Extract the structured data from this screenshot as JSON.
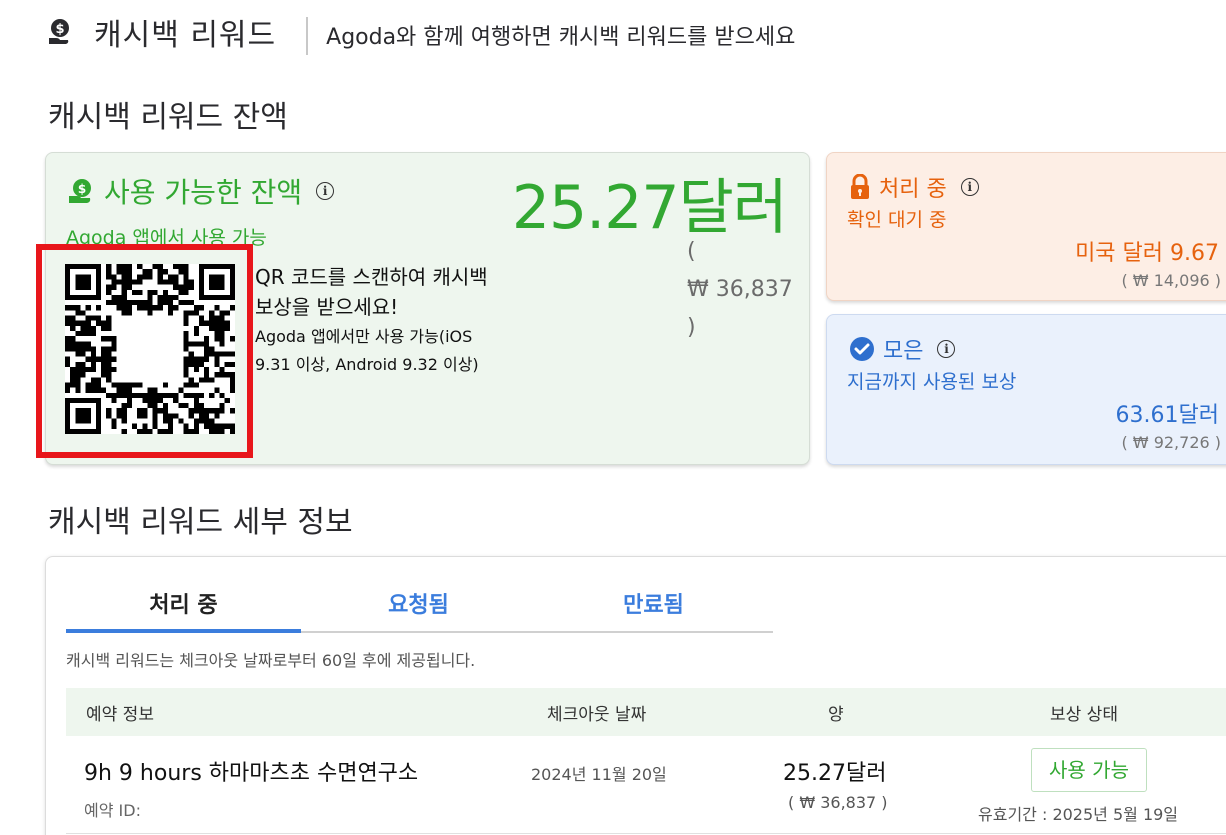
{
  "header": {
    "icon": "dollar-hand-icon",
    "title": "캐시백 리워드",
    "subtitle": "Agoda와 함께 여행하면 캐시백 리워드를 받으세요"
  },
  "balance_section": {
    "title": "캐시백 리워드 잔액",
    "available": {
      "title": "사용 가능한 잔액",
      "amount": "25.27달러",
      "subtitle": "Agoda 앱에서 사용 가능",
      "krw_open": "(",
      "krw_value": "₩ 36,837",
      "krw_close": ")",
      "qr_main": "QR 코드를 스캔하여 캐시백 보상을 받으세요!",
      "qr_sub": "Agoda 앱에서만 사용 가능(iOS 9.31 이상, Android 9.32 이상)"
    },
    "pending": {
      "title": "처리 중",
      "desc": "확인 대기 중",
      "amount": "미국 달러 9.67",
      "krw": "( ₩ 14,096 )"
    },
    "collected": {
      "title": "모은",
      "desc": "지금까지 사용된 보상",
      "amount": "63.61달러",
      "krw": "( ₩ 92,726 )"
    }
  },
  "details_section": {
    "title": "캐시백 리워드 세부 정보",
    "tabs": [
      {
        "label": "처리 중",
        "active": true
      },
      {
        "label": "요청됨",
        "active": false
      },
      {
        "label": "만료됨",
        "active": false
      }
    ],
    "notice": "캐시백 리워드는 체크아웃 날짜로부터 60일 후에 제공됩니다.",
    "columns": [
      "예약 정보",
      "체크아웃 날짜",
      "양",
      "보상 상태"
    ],
    "rows": [
      {
        "name": "9h 9 hours 하마마츠초 수면연구소",
        "booking_id": "예약 ID:",
        "checkout": "2024년 11월 20일",
        "amount": "25.27달러",
        "amount_krw": "( ₩ 36,837 )",
        "status": "사용 가능",
        "validity": "유효기간 : 2025년 5월 19일"
      }
    ]
  },
  "colors": {
    "green": "#32a832",
    "orange": "#e6620e",
    "blue": "#2e6fce",
    "highlight_red": "#e8161b"
  }
}
